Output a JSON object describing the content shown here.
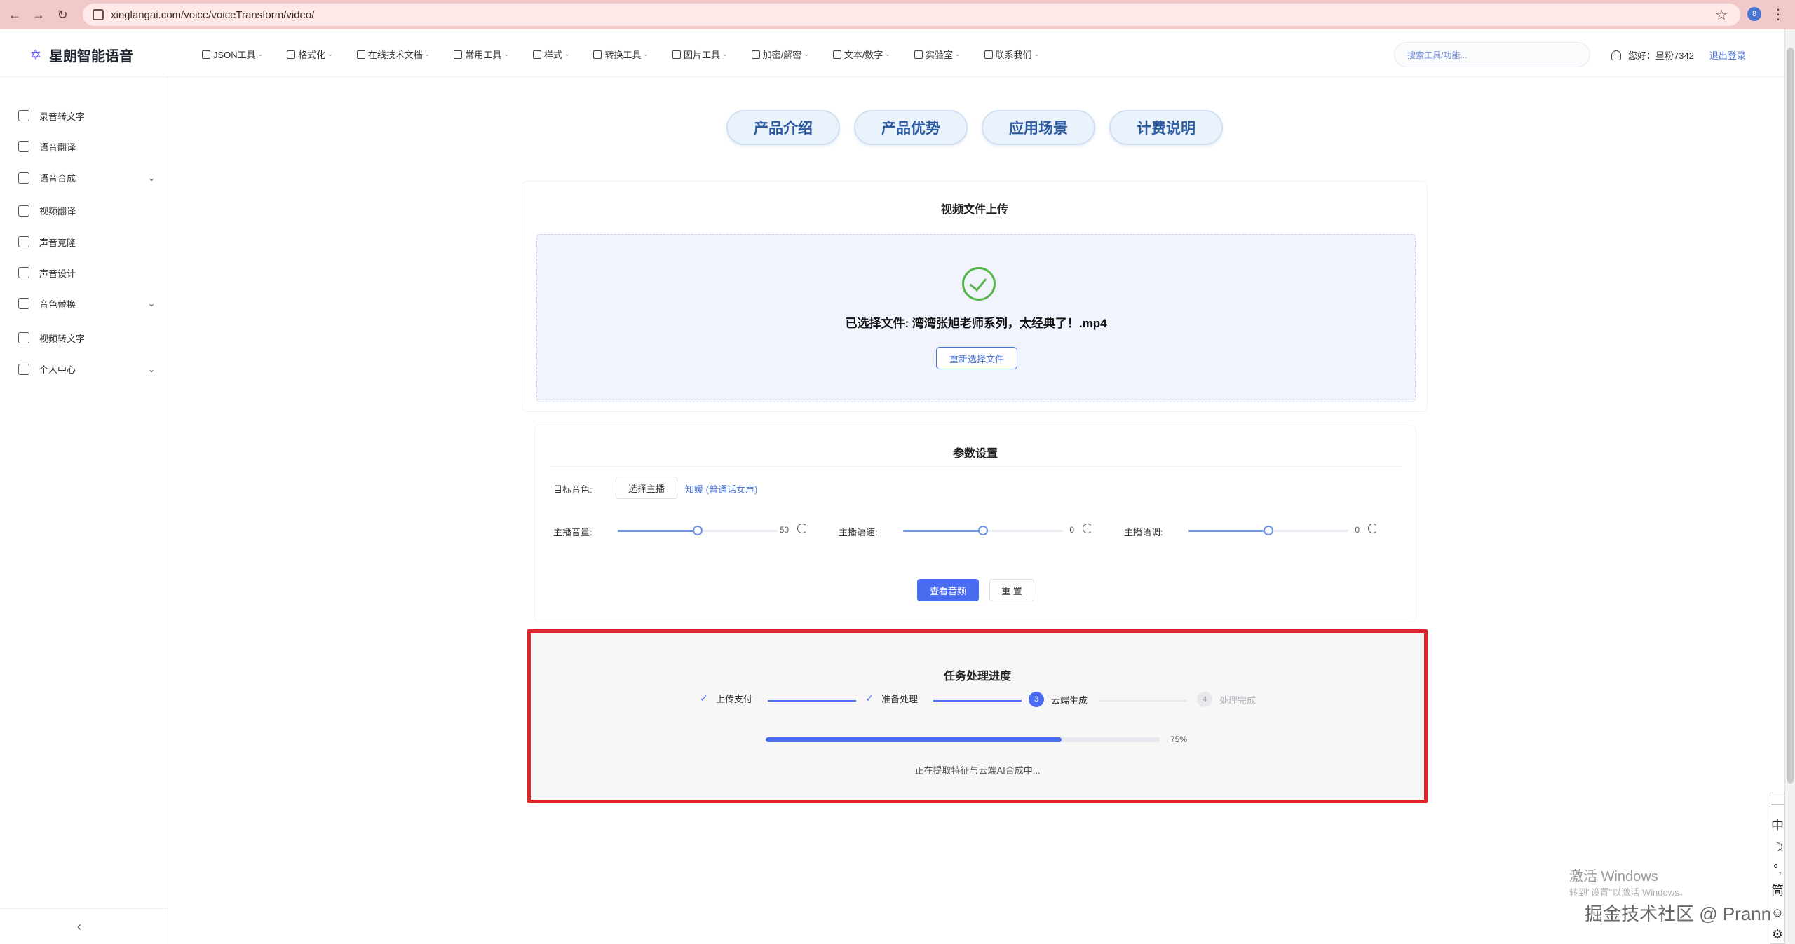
{
  "browser": {
    "url": "xinglangai.com/voice/voiceTransform/video/",
    "profile_initial": "8"
  },
  "header": {
    "brand": "星朗智能语音",
    "menu": [
      {
        "label": "JSON工具",
        "icon": "json-icon"
      },
      {
        "label": "格式化",
        "icon": "edit-icon"
      },
      {
        "label": "在线技术文档",
        "icon": "doc-icon"
      },
      {
        "label": "常用工具",
        "icon": "edit-icon"
      },
      {
        "label": "样式",
        "icon": "brush-icon"
      },
      {
        "label": "转换工具",
        "icon": "edit-icon"
      },
      {
        "label": "图片工具",
        "icon": "image-icon"
      },
      {
        "label": "加密/解密",
        "icon": "lock-icon"
      },
      {
        "label": "文本/数字",
        "icon": "edit-icon"
      },
      {
        "label": "实验室",
        "icon": "flask-icon"
      },
      {
        "label": "联系我们",
        "icon": "link-icon"
      }
    ],
    "search_placeholder": "搜索工具/功能...",
    "greeting": "您好：星粉7342",
    "logout": "退出登录"
  },
  "sidebar": {
    "items": [
      {
        "label": "录音转文字",
        "icon": "speaker-icon",
        "expandable": false
      },
      {
        "label": "语音翻译",
        "icon": "translate-icon",
        "expandable": false
      },
      {
        "label": "语音合成",
        "icon": "microphone-icon",
        "expandable": true
      },
      {
        "label": "视频翻译",
        "icon": "video-play-icon",
        "expandable": false
      },
      {
        "label": "声音克隆",
        "icon": "copy-icon",
        "expandable": false
      },
      {
        "label": "声音设计",
        "icon": "layout-icon",
        "expandable": false
      },
      {
        "label": "音色替换",
        "icon": "swap-icon",
        "expandable": true
      },
      {
        "label": "视频转文字",
        "icon": "video-camera-icon",
        "expandable": false
      },
      {
        "label": "个人中心",
        "icon": "user-icon",
        "expandable": true
      }
    ]
  },
  "tabs": [
    "产品介绍",
    "产品优势",
    "应用场景",
    "计费说明"
  ],
  "upload": {
    "title": "视频文件上传",
    "selected_file": "已选择文件: 湾湾张旭老师系列，太经典了！.mp4",
    "reselect": "重新选择文件"
  },
  "params": {
    "title": "参数设置",
    "target_label": "目标音色:",
    "choose_button": "选择主播",
    "voice_name": "知媛 (普通话女声)",
    "sliders": [
      {
        "label": "主播音量:",
        "value": "50",
        "fraction": 0.5
      },
      {
        "label": "主播语速:",
        "value": "0",
        "fraction": 0.5
      },
      {
        "label": "主播语调:",
        "value": "0",
        "fraction": 0.5
      }
    ],
    "preview_button": "查看音频",
    "reset_button": "重 置"
  },
  "progress": {
    "title": "任务处理进度",
    "steps": [
      {
        "label": "上传支付",
        "status": "done",
        "num": ""
      },
      {
        "label": "准备处理",
        "status": "done",
        "num": ""
      },
      {
        "label": "云端生成",
        "status": "active",
        "num": "3"
      },
      {
        "label": "处理完成",
        "status": "pending",
        "num": "4"
      }
    ],
    "percent": 0.75,
    "percent_text": "75%",
    "status_text": "正在提取特征与云端AI合成中..."
  },
  "watermark": {
    "win_title": "激活 Windows",
    "win_sub": "转到\"设置\"以激活 Windows。",
    "site": "掘金技术社区 @ Prannt"
  },
  "ime": [
    "—",
    "中",
    "☽",
    "°,",
    "简",
    "☺",
    "⚙"
  ],
  "colors": {
    "accent": "#4a6cf0",
    "highlight_border": "#e0242c",
    "success": "#56b64a",
    "browser_bar": "#f2c9c9"
  }
}
